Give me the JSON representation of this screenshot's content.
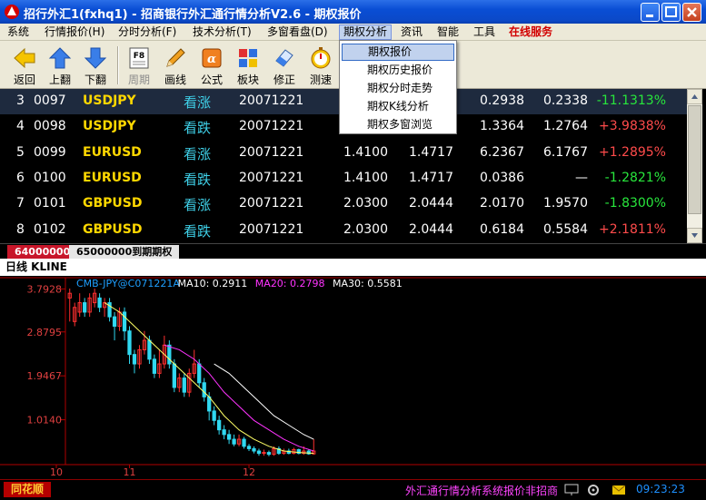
{
  "window": {
    "title": "招行外汇1(fxhq1) - 招商银行外汇通行情分析V2.6 - 期权报价"
  },
  "menu": {
    "items": [
      "系统",
      "行情报价(H)",
      "分时分析(F)",
      "技术分析(T)",
      "多窗看盘(D)",
      "期权分析",
      "资讯",
      "智能",
      "工具",
      "在线服务"
    ],
    "active": "期权分析"
  },
  "dropdown": {
    "items": [
      "期权报价",
      "期权历史报价",
      "期权分时走势",
      "期权K线分析",
      "期权多窗浏览"
    ],
    "highlighted": "期权报价"
  },
  "toolbar": {
    "buttons": [
      "返回",
      "上翻",
      "下翻",
      "周期",
      "画线",
      "公式",
      "板块",
      "修正",
      "测速"
    ]
  },
  "table": {
    "rows": [
      {
        "idx": "3",
        "code": "0097",
        "pair": "USDJPY",
        "dir": "看涨",
        "date": "20071221",
        "v1": "",
        "v2": "",
        "v3": "0.2938",
        "v4": "0.2338",
        "chg": "-11.1313%",
        "trend": "down"
      },
      {
        "idx": "4",
        "code": "0098",
        "pair": "USDJPY",
        "dir": "看跌",
        "date": "20071221",
        "v1": "",
        "v2": "",
        "v3": "1.3364",
        "v4": "1.2764",
        "chg": "+3.9838%",
        "trend": "up"
      },
      {
        "idx": "5",
        "code": "0099",
        "pair": "EURUSD",
        "dir": "看涨",
        "date": "20071221",
        "v1": "1.4100",
        "v2": "1.4717",
        "v3": "6.2367",
        "v4": "6.1767",
        "chg": "+1.2895%",
        "trend": "up"
      },
      {
        "idx": "6",
        "code": "0100",
        "pair": "EURUSD",
        "dir": "看跌",
        "date": "20071221",
        "v1": "1.4100",
        "v2": "1.4717",
        "v3": "0.0386",
        "v4": "—",
        "chg": "-1.2821%",
        "trend": "down"
      },
      {
        "idx": "7",
        "code": "0101",
        "pair": "GBPUSD",
        "dir": "看涨",
        "date": "20071221",
        "v1": "2.0300",
        "v2": "2.0444",
        "v3": "2.0170",
        "v4": "1.9570",
        "chg": "-1.8300%",
        "trend": "down"
      },
      {
        "idx": "8",
        "code": "0102",
        "pair": "GBPUSD",
        "dir": "看跌",
        "date": "20071221",
        "v1": "2.0300",
        "v2": "2.0444",
        "v3": "0.6184",
        "v4": "0.5584",
        "chg": "+2.1811%",
        "trend": "up"
      }
    ]
  },
  "tabs": [
    "64000000",
    "65000000到期期权"
  ],
  "kline": {
    "header": "日线 KLINE"
  },
  "chart_data": {
    "type": "candlestick",
    "legend": [
      {
        "label": "CMB-JPY@C071221A",
        "color": "#1e9fff"
      },
      {
        "label": "MA10: 0.2911",
        "color": "#ffffff"
      },
      {
        "label": "MA20: 0.2798",
        "color": "#ff33ff"
      },
      {
        "label": "MA30: 0.5581",
        "color": "#ffffff"
      }
    ],
    "y_ticks": [
      "3.7928",
      "2.8795",
      "1.9467",
      "1.0140"
    ],
    "y_tick_values": [
      3.7928,
      2.8795,
      1.9467,
      1.014
    ],
    "x_ticks": [
      "10",
      "11",
      "12"
    ],
    "ylim": [
      0.1,
      3.8
    ],
    "candles": [
      [
        0,
        3.6,
        3.7,
        3.1,
        3.8
      ],
      [
        1,
        3.1,
        3.4,
        3.0,
        3.5
      ],
      [
        2,
        3.3,
        3.5,
        3.2,
        3.7
      ],
      [
        3,
        3.5,
        3.3,
        3.2,
        3.6
      ],
      [
        4,
        3.3,
        3.6,
        3.2,
        3.7
      ],
      [
        5,
        3.5,
        3.7,
        3.4,
        3.8
      ],
      [
        6,
        3.6,
        3.4,
        3.3,
        3.7
      ],
      [
        7,
        3.4,
        3.5,
        3.2,
        3.6
      ],
      [
        8,
        3.5,
        3.2,
        3.1,
        3.6
      ],
      [
        9,
        3.2,
        3.0,
        2.7,
        3.3
      ],
      [
        10,
        3.0,
        3.3,
        2.9,
        3.4
      ],
      [
        11,
        3.3,
        2.9,
        2.7,
        3.4
      ],
      [
        12,
        2.9,
        2.4,
        2.2,
        3.0
      ],
      [
        13,
        2.4,
        2.2,
        2.0,
        2.5
      ],
      [
        14,
        2.2,
        2.5,
        2.1,
        2.6
      ],
      [
        15,
        2.5,
        2.7,
        2.4,
        2.9
      ],
      [
        16,
        2.7,
        2.3,
        2.2,
        2.8
      ],
      [
        17,
        2.3,
        2.0,
        1.9,
        2.4
      ],
      [
        18,
        2.0,
        2.2,
        1.9,
        2.5
      ],
      [
        19,
        2.2,
        2.6,
        2.1,
        2.8
      ],
      [
        20,
        2.6,
        2.2,
        2.1,
        2.7
      ],
      [
        21,
        2.2,
        1.7,
        1.6,
        2.3
      ],
      [
        22,
        1.7,
        1.9,
        1.6,
        2.0
      ],
      [
        23,
        1.9,
        1.6,
        1.5,
        2.0
      ],
      [
        24,
        1.6,
        2.0,
        1.5,
        2.1
      ],
      [
        25,
        2.0,
        2.2,
        1.9,
        2.5
      ],
      [
        26,
        2.2,
        1.8,
        1.7,
        2.3
      ],
      [
        27,
        1.8,
        1.5,
        1.4,
        1.9
      ],
      [
        28,
        1.5,
        1.2,
        1.0,
        1.6
      ],
      [
        29,
        1.2,
        1.0,
        0.9,
        1.3
      ],
      [
        30,
        1.0,
        0.8,
        0.7,
        1.1
      ],
      [
        31,
        0.8,
        0.7,
        0.6,
        0.9
      ],
      [
        32,
        0.7,
        0.6,
        0.5,
        0.8
      ],
      [
        33,
        0.6,
        0.5,
        0.45,
        0.7
      ],
      [
        34,
        0.5,
        0.6,
        0.45,
        0.7
      ],
      [
        35,
        0.6,
        0.45,
        0.4,
        0.65
      ],
      [
        36,
        0.45,
        0.4,
        0.35,
        0.5
      ],
      [
        37,
        0.4,
        0.35,
        0.3,
        0.45
      ],
      [
        38,
        0.35,
        0.3,
        0.25,
        0.4
      ],
      [
        39,
        0.3,
        0.32,
        0.25,
        0.38
      ],
      [
        40,
        0.32,
        0.28,
        0.24,
        0.36
      ],
      [
        41,
        0.28,
        0.4,
        0.25,
        0.45
      ],
      [
        42,
        0.4,
        0.3,
        0.27,
        0.45
      ],
      [
        43,
        0.3,
        0.35,
        0.27,
        0.4
      ],
      [
        44,
        0.35,
        0.3,
        0.28,
        0.4
      ],
      [
        45,
        0.3,
        0.38,
        0.28,
        0.42
      ],
      [
        46,
        0.38,
        0.3,
        0.28,
        0.4
      ],
      [
        47,
        0.3,
        0.35,
        0.27,
        0.45
      ],
      [
        48,
        0.35,
        0.29,
        0.27,
        0.38
      ],
      [
        49,
        0.29,
        0.35,
        0.27,
        0.6
      ]
    ],
    "ma10": [
      [
        7,
        3.5
      ],
      [
        10,
        3.3
      ],
      [
        13,
        3.0
      ],
      [
        16,
        2.7
      ],
      [
        19,
        2.4
      ],
      [
        22,
        2.1
      ],
      [
        25,
        1.8
      ],
      [
        28,
        1.5
      ],
      [
        31,
        1.1
      ],
      [
        34,
        0.8
      ],
      [
        37,
        0.6
      ],
      [
        40,
        0.45
      ],
      [
        43,
        0.35
      ],
      [
        46,
        0.32
      ],
      [
        49,
        0.3
      ]
    ],
    "ma20": [
      [
        19,
        2.6
      ],
      [
        22,
        2.5
      ],
      [
        25,
        2.3
      ],
      [
        28,
        2.0
      ],
      [
        31,
        1.6
      ],
      [
        34,
        1.3
      ],
      [
        37,
        1.0
      ],
      [
        40,
        0.8
      ],
      [
        43,
        0.6
      ],
      [
        46,
        0.45
      ],
      [
        49,
        0.35
      ]
    ],
    "ma30": [
      [
        29,
        2.2
      ],
      [
        32,
        2.0
      ],
      [
        35,
        1.7
      ],
      [
        38,
        1.4
      ],
      [
        41,
        1.1
      ],
      [
        44,
        0.9
      ],
      [
        47,
        0.7
      ],
      [
        49,
        0.6
      ]
    ]
  },
  "status": {
    "logo": "同花顺",
    "ticker": "外汇通行情分析系统报价非招商",
    "time": "09:23:23"
  }
}
